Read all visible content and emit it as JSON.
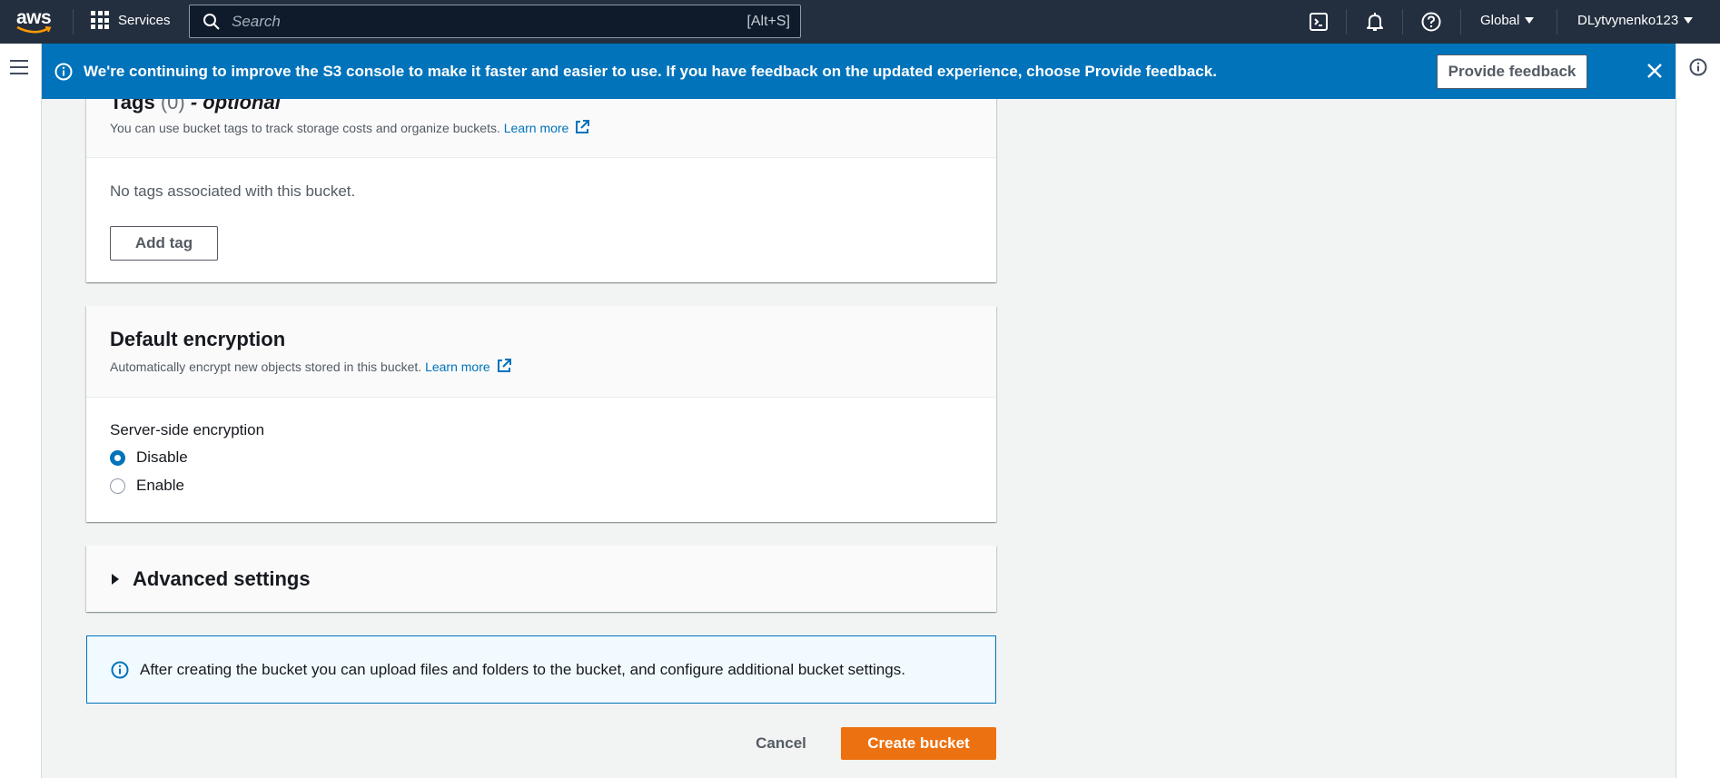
{
  "topnav": {
    "logo_text": "aws",
    "services_label": "Services",
    "search_placeholder": "Search",
    "search_shortcut": "[Alt+S]",
    "region_label": "Global",
    "account_label": "DLytvynenko123"
  },
  "flash": {
    "message": "We're continuing to improve the S3 console to make it faster and easier to use. If you have feedback on the updated experience, choose",
    "message_bold": "Provide feedback",
    "message_end": ".",
    "feedback_button": "Provide feedback"
  },
  "tags": {
    "title_main": "Tags",
    "title_count": "(0)",
    "title_suffix": "- optional",
    "description": "You can use bucket tags to track storage costs and organize buckets.",
    "learn_more": "Learn more",
    "empty_text": "No tags associated with this bucket.",
    "add_button": "Add tag"
  },
  "encryption": {
    "title": "Default encryption",
    "description": "Automatically encrypt new objects stored in this bucket.",
    "learn_more": "Learn more",
    "field_label": "Server-side encryption",
    "options": [
      {
        "label": "Disable",
        "selected": true
      },
      {
        "label": "Enable",
        "selected": false
      }
    ]
  },
  "advanced": {
    "title": "Advanced settings"
  },
  "info_alert": {
    "text": "After creating the bucket you can upload files and folders to the bucket, and configure additional bucket settings."
  },
  "actions": {
    "cancel": "Cancel",
    "create": "Create bucket"
  },
  "colors": {
    "nav_bg": "#232f3e",
    "flash_bg": "#0073bb",
    "primary_button": "#ec7211",
    "link": "#0073bb"
  }
}
